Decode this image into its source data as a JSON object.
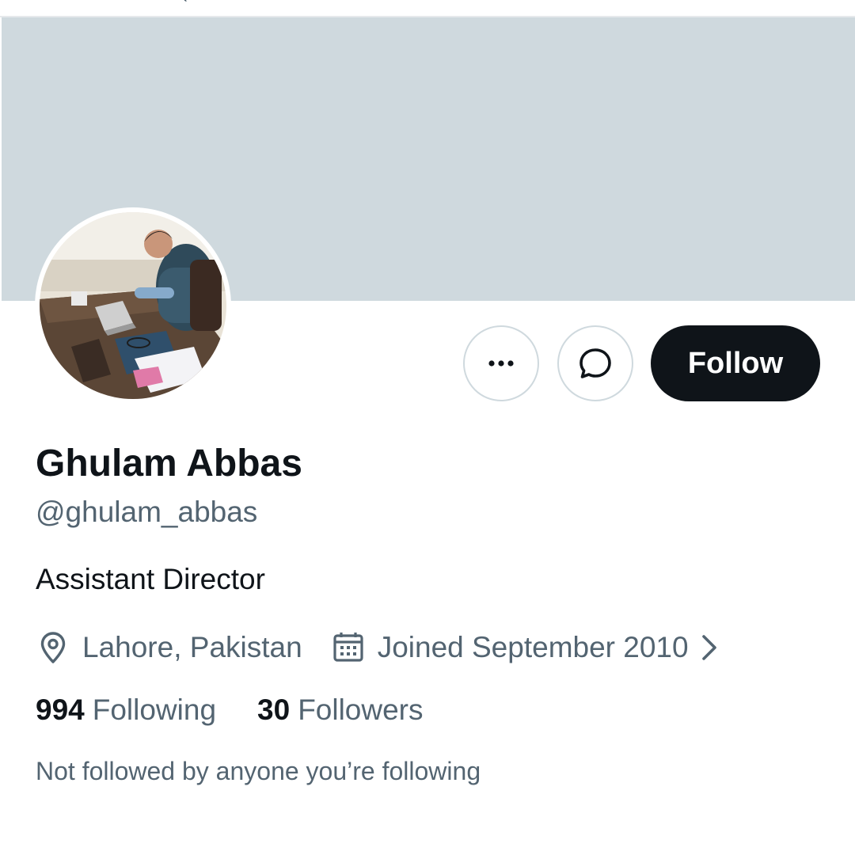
{
  "profile": {
    "name": "Ghulam Abbas",
    "handle": "@ghulam_abbas",
    "bio": "Assistant Director",
    "location": "Lahore, Pakistan",
    "joined": "Joined September 2010",
    "following_count": "994",
    "following_label": "Following",
    "followers_count": "30",
    "followers_label": "Followers",
    "not_followed_note": "Not followed by anyone you’re following"
  },
  "actions": {
    "more_icon": "more-horizontal-icon",
    "message_icon": "message-bubble-icon",
    "follow_label": "Follow"
  },
  "icons": {
    "location": "location-pin-icon",
    "calendar": "calendar-icon",
    "chevron": "chevron-right-icon"
  },
  "colors": {
    "banner": "#cfd9de",
    "primary_text": "#0f1419",
    "secondary_text": "#536471",
    "follow_button_bg": "#0f1419",
    "follow_button_text": "#ffffff",
    "border": "#cfd9de"
  }
}
